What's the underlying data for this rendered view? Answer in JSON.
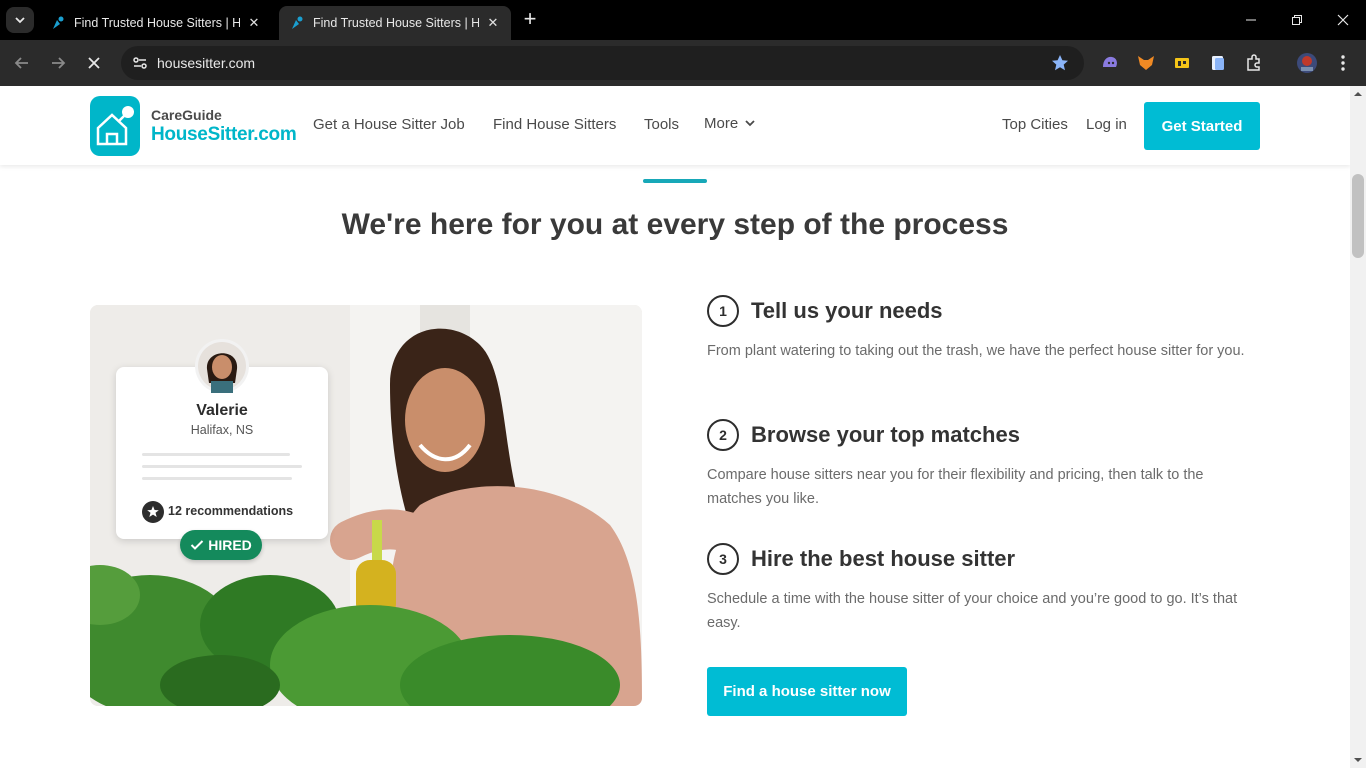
{
  "browser": {
    "tabs": [
      {
        "title": "Find Trusted House Sitters | Hou",
        "active": false
      },
      {
        "title": "Find Trusted House Sitters | Hou",
        "active": true
      }
    ],
    "url": "housesitter.com",
    "accent": "#8ab4f8"
  },
  "header": {
    "logo_top": "CareGuide",
    "logo_main": "HouseSitter.com",
    "nav": {
      "job": "Get a House Sitter Job",
      "find": "Find House Sitters",
      "tools": "Tools",
      "more": "More"
    },
    "top_cities": "Top Cities",
    "login": "Log in",
    "cta": "Get Started"
  },
  "section": {
    "headline": "We're here for you at every step of the process",
    "steps": [
      {
        "num": "1",
        "title": "Tell us your needs",
        "desc": "From plant watering to taking out the trash, we have the perfect house sitter for you."
      },
      {
        "num": "2",
        "title": "Browse your top matches",
        "desc": "Compare house sitters near you for their flexibility and pricing, then talk to the matches you like."
      },
      {
        "num": "3",
        "title": "Hire the best house sitter",
        "desc": "Schedule a time with the house sitter of your choice and you’re good to go. It’s that easy."
      }
    ],
    "cta": "Find a house sitter now"
  },
  "card": {
    "name": "Valerie",
    "location": "Halifax, NS",
    "recommendations": "12 recommendations",
    "badge": "HIRED"
  },
  "colors": {
    "brand": "#00bcd4",
    "hired": "#148a5c",
    "heading": "#3a3a3a"
  }
}
